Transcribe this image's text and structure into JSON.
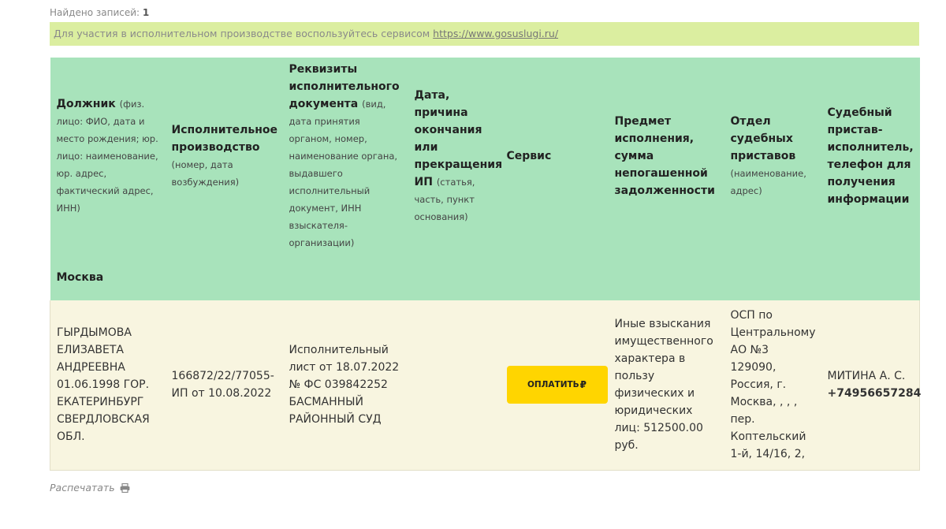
{
  "found": {
    "label": "Найдено записей:",
    "count": "1"
  },
  "notice": {
    "text": "Для участия в исполнительном производстве воспользуйтесь сервисом",
    "link": "https://www.gosuslugi.ru/"
  },
  "table": {
    "headers": [
      {
        "title": "Должник",
        "note": "(физ. лицо: ФИО, дата и место рождения; юр. лицо: наименование, юр. адрес, фактический адрес, ИНН)"
      },
      {
        "title": "Исполнительное производство",
        "note": "(номер, дата возбуждения)"
      },
      {
        "title": "Реквизиты исполнительного документа",
        "note": "(вид, дата принятия органом, номер, наименование органа, выдавшего исполнительный документ, ИНН взыскателя-организации)"
      },
      {
        "title": "Дата, причина окончания или прекращения ИП",
        "note": "(статья, часть, пункт основания)"
      },
      {
        "title": "Сервис",
        "note": ""
      },
      {
        "title": "Предмет исполнения, сумма непогашенной задолженности",
        "note": ""
      },
      {
        "title": "Отдел судебных приставов",
        "note": "(наименование, адрес)"
      },
      {
        "title": "Судебный пристав-исполнитель, телефон для получения информации",
        "note": ""
      }
    ],
    "region": "Москва",
    "row": {
      "debtor": "ГЫРДЫМОВА ЕЛИЗАВЕТА АНДРЕЕВНА 01.06.1998 ГОР. ЕКАТЕРИНБУРГ СВЕРДЛОВСКАЯ ОБЛ.",
      "proceeding": "166872/22/77055-ИП от 10.08.2022",
      "document": "Исполнительный лист от 18.07.2022 № ФС 039842252 БАСМАННЫЙ РАЙОННЫЙ СУД",
      "end": "",
      "pay_label": "ОПЛАТИТЬ",
      "currency": "₽",
      "subject": "Иные взыскания имущественного характера в пользу физических и юридических лиц: 512500.00 руб.",
      "department": "ОСП по Центральному АО №3 129090, Россия, г. Москва, , , , пер. Коптельский 1-й, 14/16, 2,",
      "bailiff": "МИТИНА А. С.",
      "phone": "+74956657284"
    }
  },
  "print": {
    "label": "Распечатать",
    "icon": "printer-icon"
  }
}
